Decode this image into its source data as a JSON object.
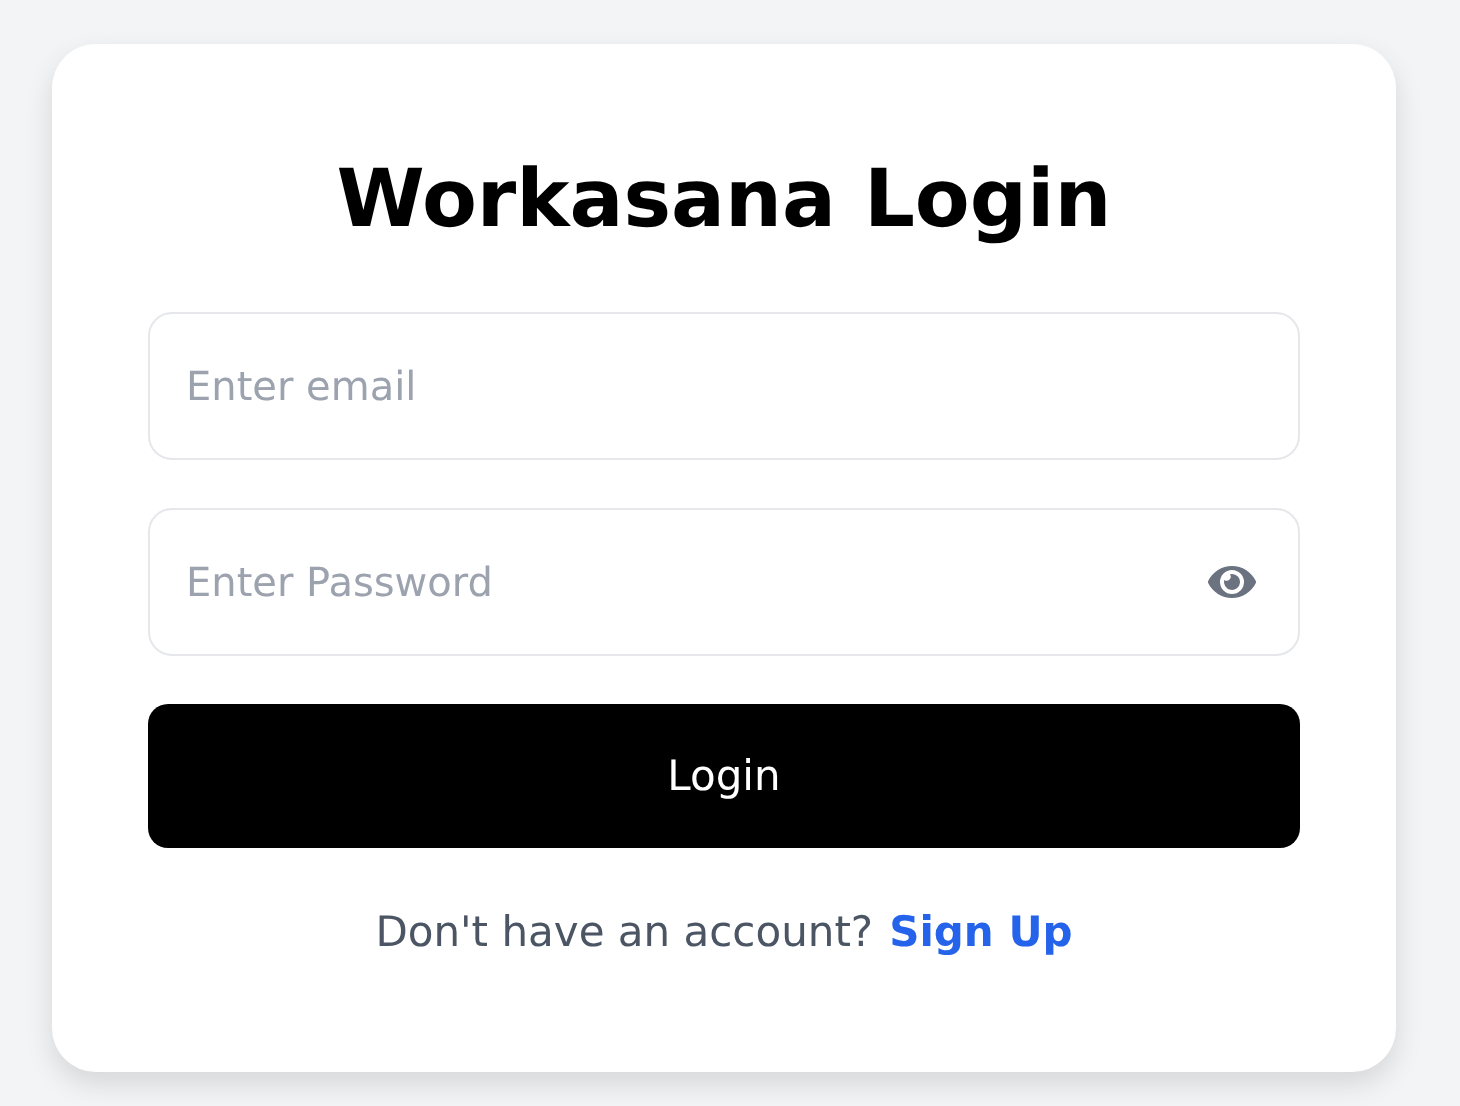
{
  "title": "Workasana Login",
  "email": {
    "placeholder": "Enter email"
  },
  "password": {
    "placeholder": "Enter Password"
  },
  "login_button": "Login",
  "footer": {
    "text": "Don't have an account?",
    "link": "Sign Up"
  }
}
